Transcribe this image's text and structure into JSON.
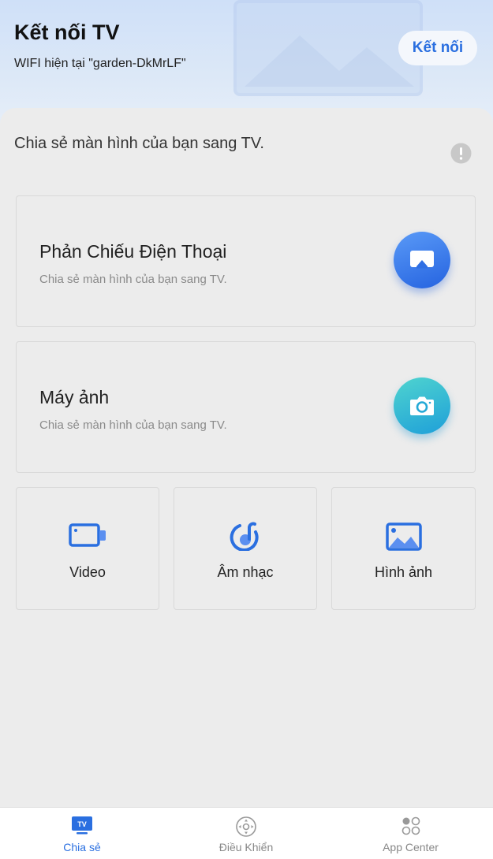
{
  "header": {
    "title": "Kết nối TV",
    "wifi_text": "WIFI hiện tại \"garden-DkMrLF\"",
    "connect_label": "Kết nối"
  },
  "main": {
    "subtitle": "Chia sẻ màn hình của bạn sang TV.",
    "cards": [
      {
        "title": "Phản Chiếu Điện Thoại",
        "desc": "Chia sẻ màn hình của bạn sang TV.",
        "icon": "screen-mirror-icon"
      },
      {
        "title": "Máy ảnh",
        "desc": "Chia sẻ màn hình của bạn sang TV.",
        "icon": "camera-icon"
      }
    ],
    "media": [
      {
        "label": "Video",
        "icon": "video-icon"
      },
      {
        "label": "Âm nhạc",
        "icon": "music-icon"
      },
      {
        "label": "Hình ảnh",
        "icon": "image-icon"
      }
    ]
  },
  "tabbar": {
    "tabs": [
      {
        "label": "Chia sẻ",
        "icon": "tv-icon",
        "active": true,
        "icon_text": "TV"
      },
      {
        "label": "Điều Khiển",
        "icon": "remote-control-icon",
        "active": false
      },
      {
        "label": "App Center",
        "icon": "app-grid-icon",
        "active": false
      }
    ]
  },
  "colors": {
    "accent": "#2a6fe0",
    "background": "#ececec",
    "header_gradient_top": "#cfe0f8"
  }
}
